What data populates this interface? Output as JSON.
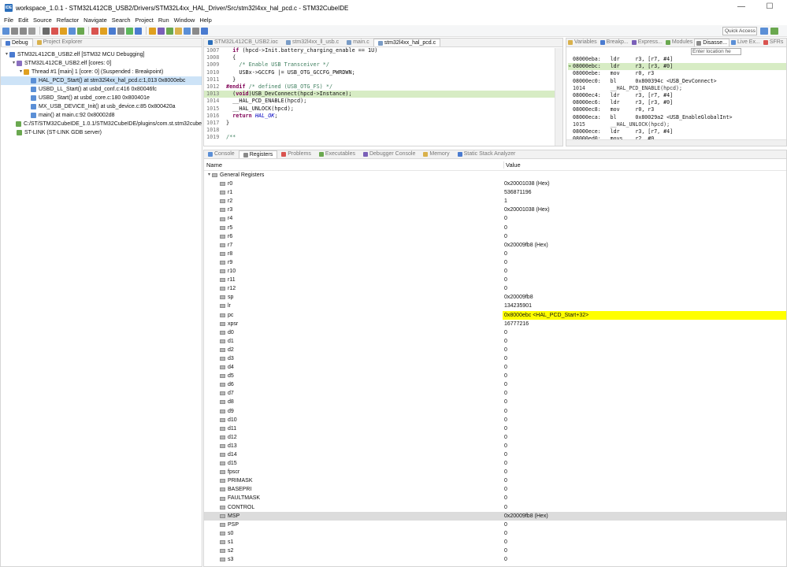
{
  "window": {
    "title": "workspace_1.0.1 - STM32L412CB_USB2/Drivers/STM32L4xx_HAL_Driver/Src/stm32l4xx_hal_pcd.c - STM32CubeIDE",
    "app_icon_text": "IDE",
    "minimize": "—",
    "maximize": "☐"
  },
  "menu": [
    "File",
    "Edit",
    "Source",
    "Refactor",
    "Navigate",
    "Search",
    "Project",
    "Run",
    "Window",
    "Help"
  ],
  "toolbar": {
    "quick_access": "Quick Access"
  },
  "debug_view": {
    "tabs": [
      "Debug",
      "Project Explorer"
    ],
    "tree": [
      {
        "label": "STM32L412CB_USB2.elf [STM32 MCU Debugging]",
        "indent": 0,
        "twisty": "▾"
      },
      {
        "label": "STM32L412CB_USB2.elf [cores: 0]",
        "indent": 1,
        "twisty": "▾"
      },
      {
        "label": "Thread #1 [main] 1 [core: 0] (Suspended : Breakpoint)",
        "indent": 2,
        "twisty": "▾"
      },
      {
        "label": "HAL_PCD_Start() at stm32l4xx_hal_pcd.c:1,013 0x8000ebc",
        "indent": 3,
        "twisty": "",
        "selected": true
      },
      {
        "label": "USBD_LL_Start() at usbd_conf.c:416 0x80046fc",
        "indent": 3,
        "twisty": ""
      },
      {
        "label": "USBD_Start() at usbd_core.c:180 0x800401e",
        "indent": 3,
        "twisty": ""
      },
      {
        "label": "MX_USB_DEVICE_Init() at usb_device.c:85 0x800420a",
        "indent": 3,
        "twisty": ""
      },
      {
        "label": "main() at main.c:92 0x80002d8",
        "indent": 3,
        "twisty": ""
      },
      {
        "label": "C:/ST/STM32CubeIDE_1.0.1/STM32CubeIDE/plugins/com.st.stm32cube",
        "indent": 1,
        "twisty": ""
      },
      {
        "label": "ST-LINK (ST-LINK GDB server)",
        "indent": 1,
        "twisty": ""
      }
    ]
  },
  "editor": {
    "tabs": [
      "STM32L412CB_USB2.ioc",
      "stm32l4xx_ll_usb.c",
      "main.c",
      "stm32l4xx_hal_pcd.c"
    ],
    "active_tab": 3,
    "lines": [
      {
        "n": "1007",
        "t": "  if (hpcd->Init.battery_charging_enable == 1U)"
      },
      {
        "n": "1008",
        "t": "  {"
      },
      {
        "n": "1009",
        "t": "    /* Enable USB Transceiver */"
      },
      {
        "n": "1010",
        "t": "    USBx->GCCFG |= USB_OTG_GCCFG_PWRDWN;"
      },
      {
        "n": "1011",
        "t": "  }"
      },
      {
        "n": "1012",
        "t": "#endif /* defined (USB_OTG_FS) */"
      },
      {
        "n": "1013",
        "t": "  (void)USB_DevConnect(hpcd->Instance);"
      },
      {
        "n": "1014",
        "t": "  __HAL_PCD_ENABLE(hpcd);"
      },
      {
        "n": "1015",
        "t": "  __HAL_UNLOCK(hpcd);"
      },
      {
        "n": "1016",
        "t": "  return HAL_OK;"
      },
      {
        "n": "1017",
        "t": "}"
      },
      {
        "n": "1018",
        "t": ""
      },
      {
        "n": "1019",
        "t": "/**"
      }
    ]
  },
  "disasm": {
    "tabs": [
      "Variables",
      "Breakp...",
      "Express...",
      "Modules",
      "Disasse...",
      "Live Ex...",
      "SFRs"
    ],
    "location_placeholder": "Enter location he",
    "lines": [
      {
        "t": "08000eba:   ldr     r3, [r7, #4]"
      },
      {
        "t": "08000ebc:   ldr     r3, [r3, #0]",
        "current": true
      },
      {
        "t": "08000ebe:   mov     r0, r3"
      },
      {
        "t": "08000ec0:   bl      0x800394c <USB_DevConnect>"
      },
      {
        "t": "1014        __HAL_PCD_ENABLE(hpcd);"
      },
      {
        "t": "08000ec4:   ldr     r3, [r7, #4]"
      },
      {
        "t": "08000ec6:   ldr     r3, [r3, #0]"
      },
      {
        "t": "08000ec8:   mov     r0, r3"
      },
      {
        "t": "08000eca:   bl      0x80029a2 <USB_EnableGlobalInt>"
      },
      {
        "t": "1015        __HAL_UNLOCK(hpcd);"
      },
      {
        "t": "08000ece:   ldr     r3, [r7, #4]"
      },
      {
        "t": "08000ed0:   movs    r2, #0"
      }
    ]
  },
  "bottom": {
    "tabs": [
      "Console",
      "Registers",
      "Problems",
      "Executables",
      "Debugger Console",
      "Memory",
      "Static Stack Analyzer"
    ],
    "active_tab": 1,
    "col_name": "Name",
    "col_value": "Value",
    "group": "General Registers",
    "registers": [
      {
        "name": "r0",
        "value": "0x20001038 (Hex)"
      },
      {
        "name": "r1",
        "value": "536871196"
      },
      {
        "name": "r2",
        "value": "1"
      },
      {
        "name": "r3",
        "value": "0x20001038 (Hex)"
      },
      {
        "name": "r4",
        "value": "0"
      },
      {
        "name": "r5",
        "value": "0"
      },
      {
        "name": "r6",
        "value": "0"
      },
      {
        "name": "r7",
        "value": "0x20009fb8 (Hex)"
      },
      {
        "name": "r8",
        "value": "0"
      },
      {
        "name": "r9",
        "value": "0"
      },
      {
        "name": "r10",
        "value": "0"
      },
      {
        "name": "r11",
        "value": "0"
      },
      {
        "name": "r12",
        "value": "0"
      },
      {
        "name": "sp",
        "value": "0x20009fb8"
      },
      {
        "name": "lr",
        "value": "134235901"
      },
      {
        "name": "pc",
        "value": "0x8000ebc <HAL_PCD_Start+32>",
        "highlight": "yellow"
      },
      {
        "name": "xpsr",
        "value": "16777216"
      },
      {
        "name": "d0",
        "value": "0"
      },
      {
        "name": "d1",
        "value": "0"
      },
      {
        "name": "d2",
        "value": "0"
      },
      {
        "name": "d3",
        "value": "0"
      },
      {
        "name": "d4",
        "value": "0"
      },
      {
        "name": "d5",
        "value": "0"
      },
      {
        "name": "d6",
        "value": "0"
      },
      {
        "name": "d7",
        "value": "0"
      },
      {
        "name": "d8",
        "value": "0"
      },
      {
        "name": "d9",
        "value": "0"
      },
      {
        "name": "d10",
        "value": "0"
      },
      {
        "name": "d11",
        "value": "0"
      },
      {
        "name": "d12",
        "value": "0"
      },
      {
        "name": "d13",
        "value": "0"
      },
      {
        "name": "d14",
        "value": "0"
      },
      {
        "name": "d15",
        "value": "0"
      },
      {
        "name": "fpscr",
        "value": "0"
      },
      {
        "name": "PRIMASK",
        "value": "0"
      },
      {
        "name": "BASEPRI",
        "value": "0"
      },
      {
        "name": "FAULTMASK",
        "value": "0"
      },
      {
        "name": "CONTROL",
        "value": "0"
      },
      {
        "name": "MSP",
        "value": "0x20009fb8 (Hex)",
        "highlight": "gray"
      },
      {
        "name": "PSP",
        "value": "0"
      },
      {
        "name": "s0",
        "value": "0"
      },
      {
        "name": "s1",
        "value": "0"
      },
      {
        "name": "s2",
        "value": "0"
      },
      {
        "name": "s3",
        "value": "0"
      }
    ]
  },
  "colors": {
    "highlight_yellow": "#ffff00",
    "current_line": "#d7ecc4",
    "selection": "#cde3f7",
    "keyword": "#7f0055",
    "comment": "#3f7f5f"
  }
}
